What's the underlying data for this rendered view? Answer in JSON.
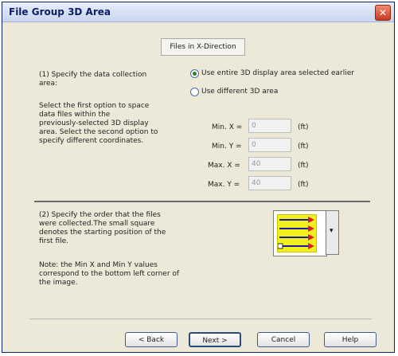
{
  "window": {
    "title": "File Group 3D Area",
    "close_icon": "close-icon"
  },
  "tab": {
    "label": "Files in X-Direction"
  },
  "section1": {
    "heading_line1": "(1) Specify the data collection",
    "heading_line2": "area:",
    "desc_line1": "Select the first option to space",
    "desc_line2": "data files within the",
    "desc_line3": "previously-selected 3D display",
    "desc_line4": "area. Select the second option to",
    "desc_line5": "specify different coordinates.",
    "option1_label": "Use entire 3D display area selected earlier",
    "option2_label": "Use different 3D area",
    "selected_option": 1
  },
  "coords": {
    "min_x_label": "Min. X =",
    "min_x_value": "0",
    "min_y_label": "Min. Y =",
    "min_y_value": "0",
    "max_x_label": "Max. X =",
    "max_x_value": "40",
    "max_y_label": "Max. Y =",
    "max_y_value": "40",
    "unit": "(ft)"
  },
  "section2": {
    "line1": "(2) Specify the order that the files",
    "line2": "were collected.The small square",
    "line3": "denotes the starting position of the",
    "line4": "first file.",
    "note1": "Note: the Min X and Min Y values",
    "note2": "correspond to the bottom left corner of",
    "note3": "the image."
  },
  "pattern": {
    "fill_color": "#f2ef1a",
    "arrow_color": "#1a1aa8",
    "arrow_head_color": "#d81e1e",
    "dropdown_icon": "chevron-down-icon"
  },
  "buttons": {
    "back": "< Back",
    "next": "Next >",
    "cancel": "Cancel",
    "help": "Help"
  }
}
